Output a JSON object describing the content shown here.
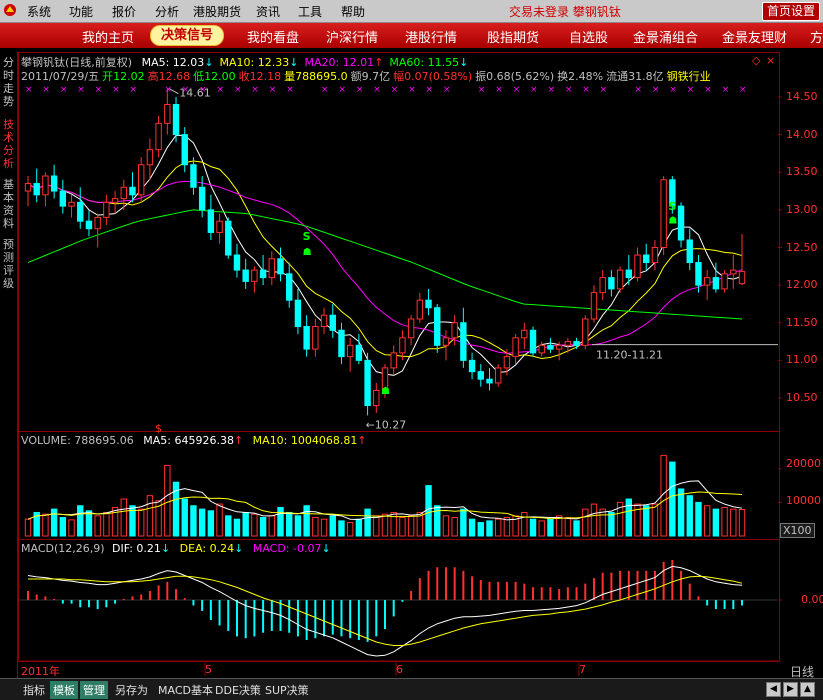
{
  "menubar": {
    "items": [
      "系统",
      "功能",
      "报价",
      "分析",
      "港股期货",
      "资讯",
      "工具",
      "帮助"
    ],
    "login_status": "交易未登录  攀钢钒钛",
    "home_settings": "首页设置"
  },
  "tabs": [
    "我的主页",
    "决策信号",
    "我的看盘",
    "沪深行情",
    "港股行情",
    "股指期货",
    "自选股",
    "金景涌组合",
    "金景友理财",
    "方"
  ],
  "active_tab": 1,
  "sidebar": [
    "分时走势",
    "技术分析",
    "基本资料",
    "预测评级"
  ],
  "price_panel": {
    "title": "攀钢钒钛(日线,前复权)",
    "ma": [
      {
        "label": "MA5: 12.03",
        "arrow": "↓",
        "color": "#ffffff"
      },
      {
        "label": "MA10: 12.33",
        "arrow": "↓",
        "color": "#ffff00"
      },
      {
        "label": "MA20: 12.01",
        "arrow": "↑",
        "color": "#ff00ff"
      },
      {
        "label": "MA60: 11.55",
        "arrow": "↓",
        "color": "#00ff00"
      }
    ],
    "info_line": [
      {
        "t": "2011/07/29/五",
        "c": "#c0c0c0"
      },
      {
        "t": "开12.02",
        "c": "#00ff00"
      },
      {
        "t": "高12.68",
        "c": "#ff3030"
      },
      {
        "t": "低12.00",
        "c": "#00ff00"
      },
      {
        "t": "收12.18",
        "c": "#ff3030"
      },
      {
        "t": "量788695.0",
        "c": "#ffff00"
      },
      {
        "t": "额9.7亿",
        "c": "#c0c0c0"
      },
      {
        "t": "幅0.07(0.58%)",
        "c": "#ff3030"
      },
      {
        "t": "振0.68(5.62%)",
        "c": "#c0c0c0"
      },
      {
        "t": "换2.48%",
        "c": "#c0c0c0"
      },
      {
        "t": "流通31.8亿",
        "c": "#c0c0c0"
      },
      {
        "t": "钢铁行业",
        "c": "#ffff00"
      }
    ],
    "y_ticks": [
      "14.50",
      "14.00",
      "13.50",
      "13.00",
      "12.50",
      "12.00",
      "11.50",
      "11.00",
      "10.50"
    ],
    "high_label": "14.61",
    "low_label": "←10.27",
    "range_label": "11.20-11.21"
  },
  "volume_panel": {
    "label": "VOLUME: 788695.06",
    "ma5": "MA5: 645926.38",
    "ma10": "MA10: 1004068.81",
    "y_ticks": [
      "20000",
      "10000"
    ],
    "unit": "X100"
  },
  "macd_panel": {
    "title": "MACD(12,26,9)",
    "dif": "DIF: 0.21",
    "dea": "DEA: 0.24",
    "macd": "MACD: -0.07",
    "y_ticks": [
      "0.00"
    ]
  },
  "time_axis": {
    "labels": [
      "2011年",
      "5",
      "6",
      "7"
    ],
    "period": "日线"
  },
  "bottom_tabs": [
    "指标",
    "模板",
    "管理",
    "另存为",
    "MACD基本",
    "DDE决策",
    "SUP决策"
  ],
  "bottom_active": [
    1,
    2
  ],
  "chart_data": {
    "type": "candlestick",
    "ylim": [
      10.2,
      14.7
    ],
    "candles": [
      [
        13.25,
        13.45,
        13.05,
        13.35
      ],
      [
        13.35,
        13.55,
        13.1,
        13.2
      ],
      [
        13.2,
        13.5,
        13.05,
        13.45
      ],
      [
        13.45,
        13.6,
        13.15,
        13.25
      ],
      [
        13.25,
        13.4,
        12.95,
        13.05
      ],
      [
        13.05,
        13.2,
        12.9,
        13.1
      ],
      [
        13.1,
        13.3,
        12.75,
        12.85
      ],
      [
        12.85,
        13.0,
        12.65,
        12.75
      ],
      [
        12.75,
        12.95,
        12.5,
        12.9
      ],
      [
        12.9,
        13.2,
        12.8,
        13.1
      ],
      [
        13.1,
        13.25,
        12.95,
        13.15
      ],
      [
        13.15,
        13.4,
        13.0,
        13.3
      ],
      [
        13.3,
        13.5,
        13.1,
        13.2
      ],
      [
        13.2,
        13.7,
        13.1,
        13.6
      ],
      [
        13.6,
        13.95,
        13.4,
        13.8
      ],
      [
        13.8,
        14.25,
        13.7,
        14.15
      ],
      [
        14.15,
        14.61,
        14.0,
        14.4
      ],
      [
        14.4,
        14.5,
        13.9,
        14.0
      ],
      [
        14.0,
        14.1,
        13.5,
        13.6
      ],
      [
        13.6,
        13.7,
        13.2,
        13.3
      ],
      [
        13.3,
        13.45,
        12.9,
        13.0
      ],
      [
        13.0,
        13.2,
        12.6,
        12.7
      ],
      [
        12.7,
        12.95,
        12.55,
        12.85
      ],
      [
        12.85,
        12.9,
        12.35,
        12.4
      ],
      [
        12.4,
        12.55,
        12.1,
        12.2
      ],
      [
        12.2,
        12.35,
        11.95,
        12.05
      ],
      [
        12.05,
        12.25,
        11.9,
        12.2
      ],
      [
        12.2,
        12.4,
        12.0,
        12.1
      ],
      [
        12.1,
        12.45,
        12.0,
        12.35
      ],
      [
        12.35,
        12.5,
        12.05,
        12.15
      ],
      [
        12.15,
        12.3,
        11.7,
        11.8
      ],
      [
        11.8,
        11.95,
        11.35,
        11.45
      ],
      [
        11.45,
        11.6,
        11.05,
        11.15
      ],
      [
        11.15,
        11.55,
        11.05,
        11.45
      ],
      [
        11.45,
        11.7,
        11.35,
        11.6
      ],
      [
        11.6,
        11.75,
        11.3,
        11.4
      ],
      [
        11.4,
        11.5,
        10.95,
        11.05
      ],
      [
        11.05,
        11.3,
        10.85,
        11.2
      ],
      [
        11.2,
        11.35,
        10.95,
        11.0
      ],
      [
        11.0,
        11.1,
        10.27,
        10.4
      ],
      [
        10.4,
        10.7,
        10.3,
        10.6
      ],
      [
        10.6,
        10.95,
        10.5,
        10.9
      ],
      [
        10.9,
        11.2,
        10.8,
        11.1
      ],
      [
        11.1,
        11.4,
        11.0,
        11.3
      ],
      [
        11.3,
        11.6,
        11.2,
        11.55
      ],
      [
        11.55,
        11.9,
        11.5,
        11.8
      ],
      [
        11.8,
        11.95,
        11.6,
        11.7
      ],
      [
        11.7,
        11.75,
        11.1,
        11.2
      ],
      [
        11.2,
        11.4,
        11.0,
        11.3
      ],
      [
        11.3,
        11.6,
        11.2,
        11.5
      ],
      [
        11.5,
        11.7,
        10.9,
        11.0
      ],
      [
        11.0,
        11.1,
        10.75,
        10.85
      ],
      [
        10.85,
        10.95,
        10.65,
        10.75
      ],
      [
        10.75,
        10.9,
        10.6,
        10.7
      ],
      [
        10.7,
        10.95,
        10.65,
        10.9
      ],
      [
        10.9,
        11.15,
        10.8,
        11.05
      ],
      [
        11.05,
        11.35,
        10.95,
        11.3
      ],
      [
        11.3,
        11.5,
        11.15,
        11.4
      ],
      [
        11.4,
        11.45,
        11.05,
        11.1
      ],
      [
        11.1,
        11.25,
        11.05,
        11.2
      ],
      [
        11.2,
        11.3,
        11.1,
        11.15
      ],
      [
        11.15,
        11.25,
        11.0,
        11.2
      ],
      [
        11.2,
        11.3,
        11.1,
        11.25
      ],
      [
        11.25,
        11.3,
        11.15,
        11.2
      ],
      [
        11.2,
        11.6,
        11.15,
        11.55
      ],
      [
        11.55,
        12.0,
        11.5,
        11.9
      ],
      [
        11.9,
        12.2,
        11.8,
        12.1
      ],
      [
        12.1,
        12.2,
        11.85,
        11.95
      ],
      [
        11.95,
        12.25,
        11.9,
        12.2
      ],
      [
        12.2,
        12.4,
        12.0,
        12.1
      ],
      [
        12.1,
        12.5,
        12.05,
        12.4
      ],
      [
        12.4,
        12.55,
        12.2,
        12.3
      ],
      [
        12.3,
        12.6,
        12.2,
        12.5
      ],
      [
        12.5,
        13.45,
        12.4,
        13.4
      ],
      [
        13.4,
        13.45,
        12.95,
        13.05
      ],
      [
        13.05,
        13.1,
        12.5,
        12.6
      ],
      [
        12.6,
        12.75,
        12.2,
        12.3
      ],
      [
        12.3,
        12.4,
        11.9,
        12.0
      ],
      [
        12.0,
        12.2,
        11.8,
        12.1
      ],
      [
        12.1,
        12.3,
        11.9,
        11.95
      ],
      [
        11.95,
        12.2,
        11.9,
        12.15
      ],
      [
        12.15,
        12.4,
        11.95,
        12.2
      ],
      [
        12.02,
        12.68,
        12.0,
        12.18
      ]
    ],
    "ma_series": [
      {
        "name": "MA5",
        "color": "#ffffff"
      },
      {
        "name": "MA10",
        "color": "#ffff00"
      },
      {
        "name": "MA20",
        "color": "#ff00ff"
      },
      {
        "name": "MA60",
        "color": "#00ff00"
      }
    ],
    "volume_ylim": [
      0,
      25000
    ],
    "volume": [
      5000,
      7000,
      6500,
      8000,
      5500,
      4800,
      9000,
      7500,
      6000,
      7000,
      8500,
      11000,
      9000,
      8000,
      12000,
      10500,
      21000,
      16000,
      11000,
      9000,
      8000,
      7500,
      9500,
      6000,
      5000,
      7000,
      6500,
      5500,
      6000,
      8500,
      7000,
      6000,
      9000,
      5500,
      5000,
      6000,
      4500,
      4000,
      5000,
      8000,
      6000,
      6500,
      7000,
      5500,
      6000,
      7000,
      15000,
      9000,
      6000,
      5500,
      8000,
      5000,
      4000,
      4500,
      5000,
      5500,
      6000,
      7000,
      5000,
      4500,
      5000,
      6000,
      5500,
      4500,
      8000,
      9500,
      8000,
      7000,
      10000,
      11000,
      9500,
      9000,
      9500,
      24000,
      22000,
      14000,
      12000,
      10000,
      9000,
      8000,
      8500,
      8000,
      7888
    ],
    "dif": [
      0.35,
      0.33,
      0.32,
      0.3,
      0.28,
      0.27,
      0.25,
      0.24,
      0.22,
      0.22,
      0.24,
      0.26,
      0.28,
      0.3,
      0.33,
      0.38,
      0.42,
      0.4,
      0.35,
      0.3,
      0.25,
      0.18,
      0.12,
      0.05,
      -0.02,
      -0.08,
      -0.12,
      -0.15,
      -0.18,
      -0.22,
      -0.28,
      -0.35,
      -0.42,
      -0.46,
      -0.5,
      -0.54,
      -0.6,
      -0.66,
      -0.72,
      -0.78,
      -0.8,
      -0.79,
      -0.74,
      -0.66,
      -0.58,
      -0.48,
      -0.4,
      -0.34,
      -0.3,
      -0.26,
      -0.24,
      -0.24,
      -0.23,
      -0.22,
      -0.2,
      -0.18,
      -0.16,
      -0.15,
      -0.15,
      -0.14,
      -0.13,
      -0.12,
      -0.1,
      -0.08,
      -0.04,
      0.02,
      0.08,
      0.12,
      0.16,
      0.2,
      0.24,
      0.28,
      0.32,
      0.42,
      0.48,
      0.46,
      0.42,
      0.36,
      0.3,
      0.26,
      0.24,
      0.22,
      0.21
    ],
    "dea": [
      0.3,
      0.3,
      0.3,
      0.3,
      0.3,
      0.29,
      0.29,
      0.28,
      0.27,
      0.26,
      0.26,
      0.26,
      0.26,
      0.27,
      0.28,
      0.3,
      0.32,
      0.34,
      0.34,
      0.33,
      0.31,
      0.29,
      0.26,
      0.22,
      0.18,
      0.13,
      0.08,
      0.03,
      -0.01,
      -0.05,
      -0.1,
      -0.15,
      -0.2,
      -0.25,
      -0.3,
      -0.35,
      -0.4,
      -0.45,
      -0.5,
      -0.55,
      -0.6,
      -0.63,
      -0.65,
      -0.65,
      -0.63,
      -0.6,
      -0.56,
      -0.52,
      -0.48,
      -0.44,
      -0.4,
      -0.37,
      -0.34,
      -0.32,
      -0.3,
      -0.28,
      -0.26,
      -0.24,
      -0.22,
      -0.21,
      -0.2,
      -0.18,
      -0.17,
      -0.15,
      -0.13,
      -0.1,
      -0.07,
      -0.03,
      0.0,
      0.04,
      0.08,
      0.12,
      0.16,
      0.21,
      0.26,
      0.3,
      0.33,
      0.34,
      0.33,
      0.31,
      0.29,
      0.27,
      0.24
    ]
  }
}
